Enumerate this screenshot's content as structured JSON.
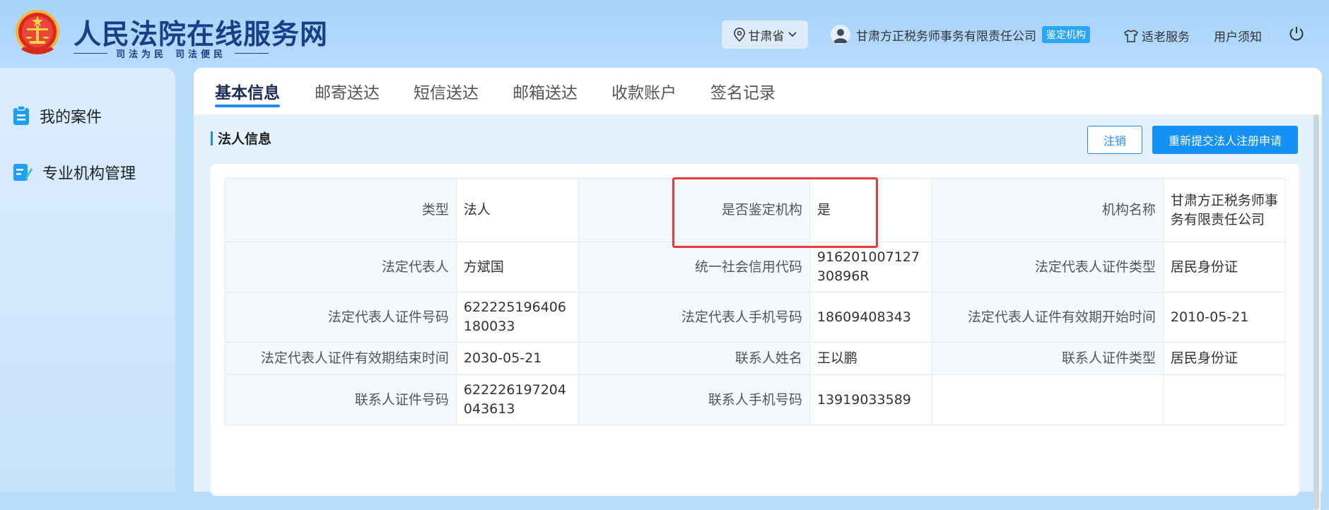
{
  "header": {
    "site_title": "人民法院在线服务网",
    "slogan_1": "司法为民",
    "slogan_2": "司法便民",
    "region": "甘肃省",
    "user_name": "甘肃方正税务师事务有限责任公司",
    "role_badge": "鉴定机构",
    "elderly_service": "适老服务",
    "user_notice": "用户须知"
  },
  "sidebar": {
    "items": [
      {
        "label": "我的案件",
        "icon": "clipboard-icon"
      },
      {
        "label": "专业机构管理",
        "icon": "edit-doc-icon"
      }
    ]
  },
  "tabs": [
    "基本信息",
    "邮寄送达",
    "短信送达",
    "邮箱送达",
    "收款账户",
    "签名记录"
  ],
  "active_tab": "基本信息",
  "section": {
    "title": "法人信息",
    "cancel_label": "注销",
    "resubmit_label": "重新提交法人注册申请"
  },
  "info_rows": [
    [
      {
        "label": "类型",
        "value": "法人"
      },
      {
        "label": "是否鉴定机构",
        "value": "是"
      },
      {
        "label": "机构名称",
        "value": "甘肃方正税务师事务有限责任公司"
      }
    ],
    [
      {
        "label": "法定代表人",
        "value": "方斌国"
      },
      {
        "label": "统一社会信用代码",
        "value": "91620100712730896R"
      },
      {
        "label": "法定代表人证件类型",
        "value": "居民身份证"
      }
    ],
    [
      {
        "label": "法定代表人证件号码",
        "value": "622225196406180033"
      },
      {
        "label": "法定代表人手机号码",
        "value": "18609408343"
      },
      {
        "label": "法定代表人证件有效期开始时间",
        "value": "2010-05-21"
      }
    ],
    [
      {
        "label": "法定代表人证件有效期结束时间",
        "value": "2030-05-21"
      },
      {
        "label": "联系人姓名",
        "value": "王以鹏"
      },
      {
        "label": "联系人证件类型",
        "value": "居民身份证"
      }
    ],
    [
      {
        "label": "联系人证件号码",
        "value": "622226197204043613"
      },
      {
        "label": "联系人手机号码",
        "value": "13919033589"
      },
      {
        "label": "",
        "value": ""
      }
    ]
  ],
  "colors": {
    "accent": "#1f8cf0",
    "header_bg": "#a7d3fb",
    "title": "#1b3f86",
    "highlight": "#ea3b3b",
    "badge": "#2aa6f7"
  }
}
